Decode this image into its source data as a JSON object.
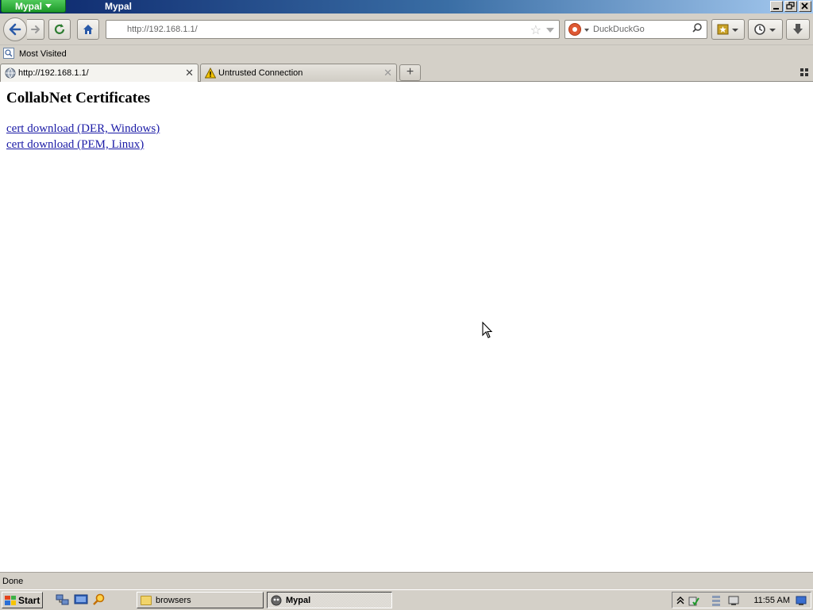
{
  "window": {
    "app_button_label": "Mypal",
    "title": "Mypal",
    "caption_buttons": [
      "minimize",
      "restore",
      "close"
    ]
  },
  "navbar": {
    "url": "http://192.168.1.1/",
    "search_placeholder": "DuckDuckGo"
  },
  "bookmarks": {
    "items": [
      {
        "label": "Most Visited"
      }
    ]
  },
  "tabs": [
    {
      "label": "http://192.168.1.1/",
      "active": true
    },
    {
      "label": "Untrusted Connection",
      "active": false
    }
  ],
  "page": {
    "heading": "CollabNet Certificates",
    "links": [
      {
        "label": "cert download (DER, Windows)"
      },
      {
        "label": "cert download (PEM, Linux)"
      }
    ]
  },
  "status": {
    "text": "Done"
  },
  "taskbar": {
    "start_label": "Start",
    "buttons": [
      {
        "label": "browsers",
        "pressed": false
      },
      {
        "label": "Mypal",
        "pressed": true
      }
    ],
    "clock": "11:55 AM"
  },
  "colors": {
    "link": "#1a1aa6",
    "app_button": "#2aa836",
    "titlebar_start": "#0a246a",
    "titlebar_end": "#a6caf0"
  }
}
